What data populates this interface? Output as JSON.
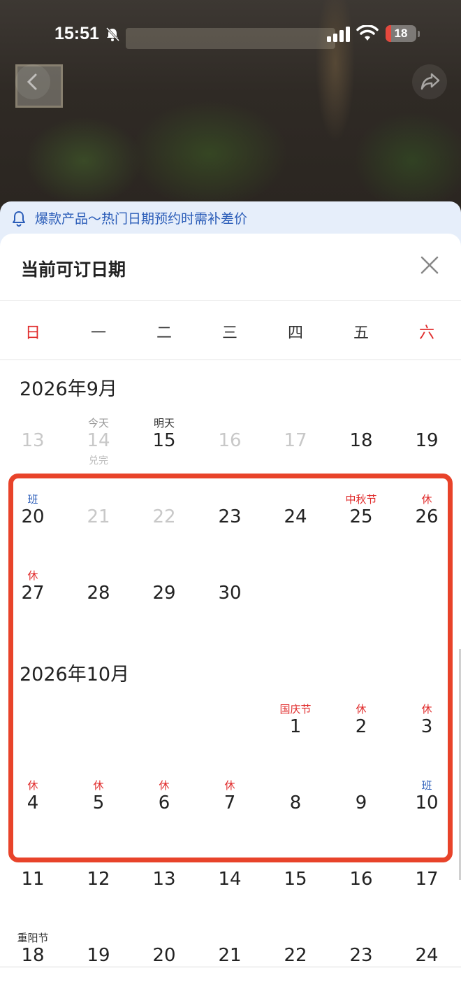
{
  "status_bar": {
    "time": "15:51",
    "battery": "18",
    "battery_level": 0.18
  },
  "notice": {
    "text": "爆款产品～热门日期预约时需补差价"
  },
  "sheet": {
    "title": "当前可订日期"
  },
  "weekdays": [
    "日",
    "一",
    "二",
    "三",
    "四",
    "五",
    "六"
  ],
  "months": [
    {
      "title": "2026年9月",
      "rows": [
        [
          {
            "day": "13",
            "disabled": true
          },
          {
            "day": "14",
            "top": "今天",
            "top_style": "gray",
            "bottom": "兑完",
            "disabled": true
          },
          {
            "day": "15",
            "top": "明天",
            "top_style": "dark"
          },
          {
            "day": "16",
            "disabled": true
          },
          {
            "day": "17",
            "disabled": true
          },
          {
            "day": "18"
          },
          {
            "day": "19"
          }
        ],
        [
          {
            "day": "20",
            "top": "班",
            "top_style": "blue"
          },
          {
            "day": "21",
            "disabled": true
          },
          {
            "day": "22",
            "disabled": true
          },
          {
            "day": "23"
          },
          {
            "day": "24"
          },
          {
            "day": "25",
            "top": "中秋节",
            "top_style": "red"
          },
          {
            "day": "26",
            "top": "休",
            "top_style": "red"
          }
        ],
        [
          {
            "day": "27",
            "top": "休",
            "top_style": "red"
          },
          {
            "day": "28"
          },
          {
            "day": "29"
          },
          {
            "day": "30"
          },
          null,
          null,
          null
        ]
      ]
    },
    {
      "title": "2026年10月",
      "rows": [
        [
          null,
          null,
          null,
          null,
          {
            "day": "1",
            "top": "国庆节",
            "top_style": "red"
          },
          {
            "day": "2",
            "top": "休",
            "top_style": "red"
          },
          {
            "day": "3",
            "top": "休",
            "top_style": "red"
          }
        ],
        [
          {
            "day": "4",
            "top": "休",
            "top_style": "red"
          },
          {
            "day": "5",
            "top": "休",
            "top_style": "red"
          },
          {
            "day": "6",
            "top": "休",
            "top_style": "red"
          },
          {
            "day": "7",
            "top": "休",
            "top_style": "red"
          },
          {
            "day": "8"
          },
          {
            "day": "9"
          },
          {
            "day": "10",
            "top": "班",
            "top_style": "blue"
          }
        ],
        [
          {
            "day": "11"
          },
          {
            "day": "12"
          },
          {
            "day": "13"
          },
          {
            "day": "14"
          },
          {
            "day": "15"
          },
          {
            "day": "16"
          },
          {
            "day": "17"
          }
        ],
        [
          {
            "day": "18",
            "top": "重阳节",
            "top_style": "dark"
          },
          {
            "day": "19"
          },
          {
            "day": "20"
          },
          {
            "day": "21"
          },
          {
            "day": "22"
          },
          {
            "day": "23"
          },
          {
            "day": "24"
          }
        ]
      ]
    }
  ]
}
